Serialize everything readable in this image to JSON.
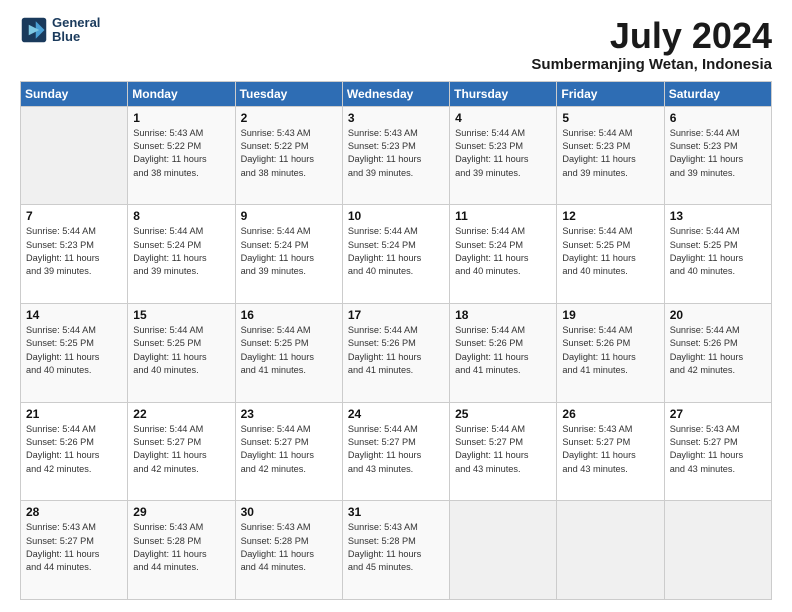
{
  "logo": {
    "line1": "General",
    "line2": "Blue"
  },
  "title": "July 2024",
  "subtitle": "Sumbermanjing Wetan, Indonesia",
  "days_header": [
    "Sunday",
    "Monday",
    "Tuesday",
    "Wednesday",
    "Thursday",
    "Friday",
    "Saturday"
  ],
  "weeks": [
    [
      {
        "day": "",
        "info": ""
      },
      {
        "day": "1",
        "info": "Sunrise: 5:43 AM\nSunset: 5:22 PM\nDaylight: 11 hours\nand 38 minutes."
      },
      {
        "day": "2",
        "info": "Sunrise: 5:43 AM\nSunset: 5:22 PM\nDaylight: 11 hours\nand 38 minutes."
      },
      {
        "day": "3",
        "info": "Sunrise: 5:43 AM\nSunset: 5:23 PM\nDaylight: 11 hours\nand 39 minutes."
      },
      {
        "day": "4",
        "info": "Sunrise: 5:44 AM\nSunset: 5:23 PM\nDaylight: 11 hours\nand 39 minutes."
      },
      {
        "day": "5",
        "info": "Sunrise: 5:44 AM\nSunset: 5:23 PM\nDaylight: 11 hours\nand 39 minutes."
      },
      {
        "day": "6",
        "info": "Sunrise: 5:44 AM\nSunset: 5:23 PM\nDaylight: 11 hours\nand 39 minutes."
      }
    ],
    [
      {
        "day": "7",
        "info": "Sunrise: 5:44 AM\nSunset: 5:23 PM\nDaylight: 11 hours\nand 39 minutes."
      },
      {
        "day": "8",
        "info": "Sunrise: 5:44 AM\nSunset: 5:24 PM\nDaylight: 11 hours\nand 39 minutes."
      },
      {
        "day": "9",
        "info": "Sunrise: 5:44 AM\nSunset: 5:24 PM\nDaylight: 11 hours\nand 39 minutes."
      },
      {
        "day": "10",
        "info": "Sunrise: 5:44 AM\nSunset: 5:24 PM\nDaylight: 11 hours\nand 40 minutes."
      },
      {
        "day": "11",
        "info": "Sunrise: 5:44 AM\nSunset: 5:24 PM\nDaylight: 11 hours\nand 40 minutes."
      },
      {
        "day": "12",
        "info": "Sunrise: 5:44 AM\nSunset: 5:25 PM\nDaylight: 11 hours\nand 40 minutes."
      },
      {
        "day": "13",
        "info": "Sunrise: 5:44 AM\nSunset: 5:25 PM\nDaylight: 11 hours\nand 40 minutes."
      }
    ],
    [
      {
        "day": "14",
        "info": "Sunrise: 5:44 AM\nSunset: 5:25 PM\nDaylight: 11 hours\nand 40 minutes."
      },
      {
        "day": "15",
        "info": "Sunrise: 5:44 AM\nSunset: 5:25 PM\nDaylight: 11 hours\nand 40 minutes."
      },
      {
        "day": "16",
        "info": "Sunrise: 5:44 AM\nSunset: 5:25 PM\nDaylight: 11 hours\nand 41 minutes."
      },
      {
        "day": "17",
        "info": "Sunrise: 5:44 AM\nSunset: 5:26 PM\nDaylight: 11 hours\nand 41 minutes."
      },
      {
        "day": "18",
        "info": "Sunrise: 5:44 AM\nSunset: 5:26 PM\nDaylight: 11 hours\nand 41 minutes."
      },
      {
        "day": "19",
        "info": "Sunrise: 5:44 AM\nSunset: 5:26 PM\nDaylight: 11 hours\nand 41 minutes."
      },
      {
        "day": "20",
        "info": "Sunrise: 5:44 AM\nSunset: 5:26 PM\nDaylight: 11 hours\nand 42 minutes."
      }
    ],
    [
      {
        "day": "21",
        "info": "Sunrise: 5:44 AM\nSunset: 5:26 PM\nDaylight: 11 hours\nand 42 minutes."
      },
      {
        "day": "22",
        "info": "Sunrise: 5:44 AM\nSunset: 5:27 PM\nDaylight: 11 hours\nand 42 minutes."
      },
      {
        "day": "23",
        "info": "Sunrise: 5:44 AM\nSunset: 5:27 PM\nDaylight: 11 hours\nand 42 minutes."
      },
      {
        "day": "24",
        "info": "Sunrise: 5:44 AM\nSunset: 5:27 PM\nDaylight: 11 hours\nand 43 minutes."
      },
      {
        "day": "25",
        "info": "Sunrise: 5:44 AM\nSunset: 5:27 PM\nDaylight: 11 hours\nand 43 minutes."
      },
      {
        "day": "26",
        "info": "Sunrise: 5:43 AM\nSunset: 5:27 PM\nDaylight: 11 hours\nand 43 minutes."
      },
      {
        "day": "27",
        "info": "Sunrise: 5:43 AM\nSunset: 5:27 PM\nDaylight: 11 hours\nand 43 minutes."
      }
    ],
    [
      {
        "day": "28",
        "info": "Sunrise: 5:43 AM\nSunset: 5:27 PM\nDaylight: 11 hours\nand 44 minutes."
      },
      {
        "day": "29",
        "info": "Sunrise: 5:43 AM\nSunset: 5:28 PM\nDaylight: 11 hours\nand 44 minutes."
      },
      {
        "day": "30",
        "info": "Sunrise: 5:43 AM\nSunset: 5:28 PM\nDaylight: 11 hours\nand 44 minutes."
      },
      {
        "day": "31",
        "info": "Sunrise: 5:43 AM\nSunset: 5:28 PM\nDaylight: 11 hours\nand 45 minutes."
      },
      {
        "day": "",
        "info": ""
      },
      {
        "day": "",
        "info": ""
      },
      {
        "day": "",
        "info": ""
      }
    ]
  ]
}
